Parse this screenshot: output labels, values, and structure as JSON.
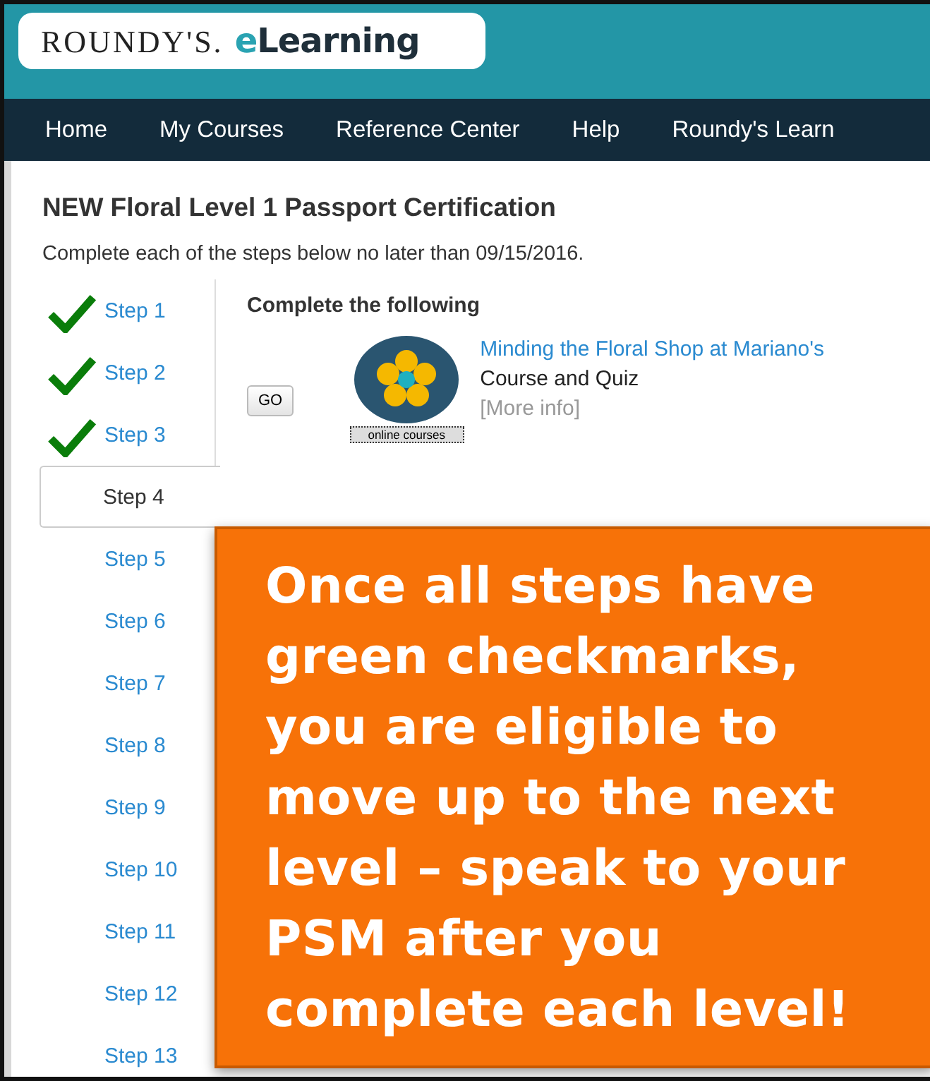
{
  "logo": {
    "brand": "ROUNDY'S.",
    "product": "eLearning"
  },
  "nav": [
    "Home",
    "My Courses",
    "Reference Center",
    "Help",
    "Roundy's Learn"
  ],
  "page": {
    "title": "NEW Floral Level 1 Passport Certification",
    "subtitle": "Complete each of the steps below no later than 09/15/2016."
  },
  "steps": [
    {
      "label": "Step 1",
      "completed": true,
      "selected": false
    },
    {
      "label": "Step 2",
      "completed": true,
      "selected": false
    },
    {
      "label": "Step 3",
      "completed": true,
      "selected": false
    },
    {
      "label": "Step 4",
      "completed": false,
      "selected": true
    },
    {
      "label": "Step 5",
      "completed": false,
      "selected": false
    },
    {
      "label": "Step 6",
      "completed": false,
      "selected": false
    },
    {
      "label": "Step 7",
      "completed": false,
      "selected": false
    },
    {
      "label": "Step 8",
      "completed": false,
      "selected": false
    },
    {
      "label": "Step 9",
      "completed": false,
      "selected": false
    },
    {
      "label": "Step 10",
      "completed": false,
      "selected": false
    },
    {
      "label": "Step 11",
      "completed": false,
      "selected": false
    },
    {
      "label": "Step 12",
      "completed": false,
      "selected": false
    },
    {
      "label": "Step 13",
      "completed": false,
      "selected": false
    }
  ],
  "panel": {
    "heading": "Complete the following",
    "go_button": "GO",
    "thumbnail_caption": "online courses",
    "course_title": "Minding the Floral Shop at Mariano's",
    "course_type": "Course and Quiz",
    "more_info": "[More info]"
  },
  "callout": "Once all steps have green checkmarks, you are eligible to move up to the next level – speak to your PSM after you complete each level!"
}
